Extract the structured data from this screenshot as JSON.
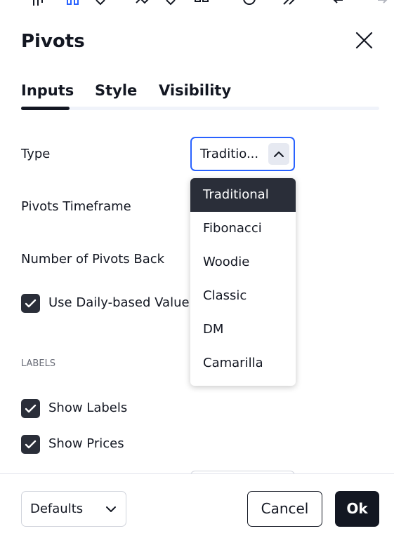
{
  "dialog": {
    "title": "Pivots"
  },
  "tabs": [
    {
      "label": "Inputs",
      "active": true
    },
    {
      "label": "Style",
      "active": false
    },
    {
      "label": "Visibility",
      "active": false
    }
  ],
  "inputs": {
    "type_label": "Type",
    "type_value": "Traditio...",
    "timeframe_label": "Pivots Timeframe",
    "pivots_back_label": "Number of Pivots Back",
    "daily_based_label": "Use Daily-based Value",
    "daily_based_checked": true
  },
  "labels_section": {
    "header": "LABELS",
    "show_labels": "Show Labels",
    "show_labels_checked": true,
    "show_prices": "Show Prices",
    "show_prices_checked": true
  },
  "dropdown": {
    "options": [
      "Traditional",
      "Fibonacci",
      "Woodie",
      "Classic",
      "DM",
      "Camarilla"
    ],
    "selected": "Traditional"
  },
  "footer": {
    "defaults_label": "Defaults",
    "cancel_label": "Cancel",
    "ok_label": "Ok"
  },
  "icons": {
    "close": "close-icon",
    "check": "check-icon",
    "chevron_up": "chevron-up-icon",
    "chevron_down": "chevron-down-icon"
  },
  "colors": {
    "accent_blue": "#2962ff",
    "dark": "#131722",
    "checkbox": "#2a2e39",
    "muted": "#6a6d78"
  }
}
